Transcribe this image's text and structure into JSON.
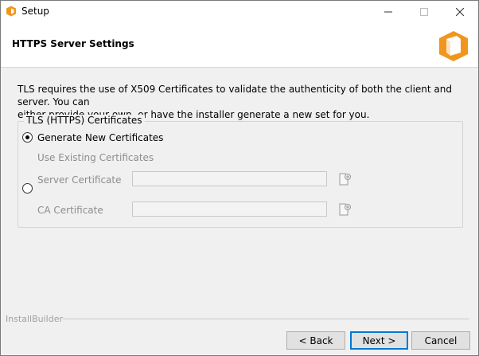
{
  "window": {
    "title": "Setup"
  },
  "header": {
    "title": "HTTPS Server Settings"
  },
  "description": {
    "line1": "TLS requires the use of X509 Certificates to validate the authenticity of both the client and server. You can",
    "line2": "either provide your own, or have the installer generate a new set for you."
  },
  "group": {
    "legend": "TLS (HTTPS) Certificates",
    "option_generate": {
      "label": "Generate New Certificates",
      "selected": true
    },
    "option_existing": {
      "label": "Use Existing Certificates",
      "selected": false,
      "server_certificate": {
        "label": "Server Certificate",
        "value": ""
      },
      "ca_certificate": {
        "label": "CA Certificate",
        "value": ""
      }
    }
  },
  "footer": {
    "brand": "InstallBuilder",
    "back_label": "< Back",
    "next_label": "Next >",
    "cancel_label": "Cancel"
  },
  "icons": {
    "app": "installer-box-icon",
    "logo": "installer-box-logo-icon",
    "browse": "browse-file-icon",
    "accent_color": "#f0961e",
    "focus_color": "#0078d7"
  }
}
